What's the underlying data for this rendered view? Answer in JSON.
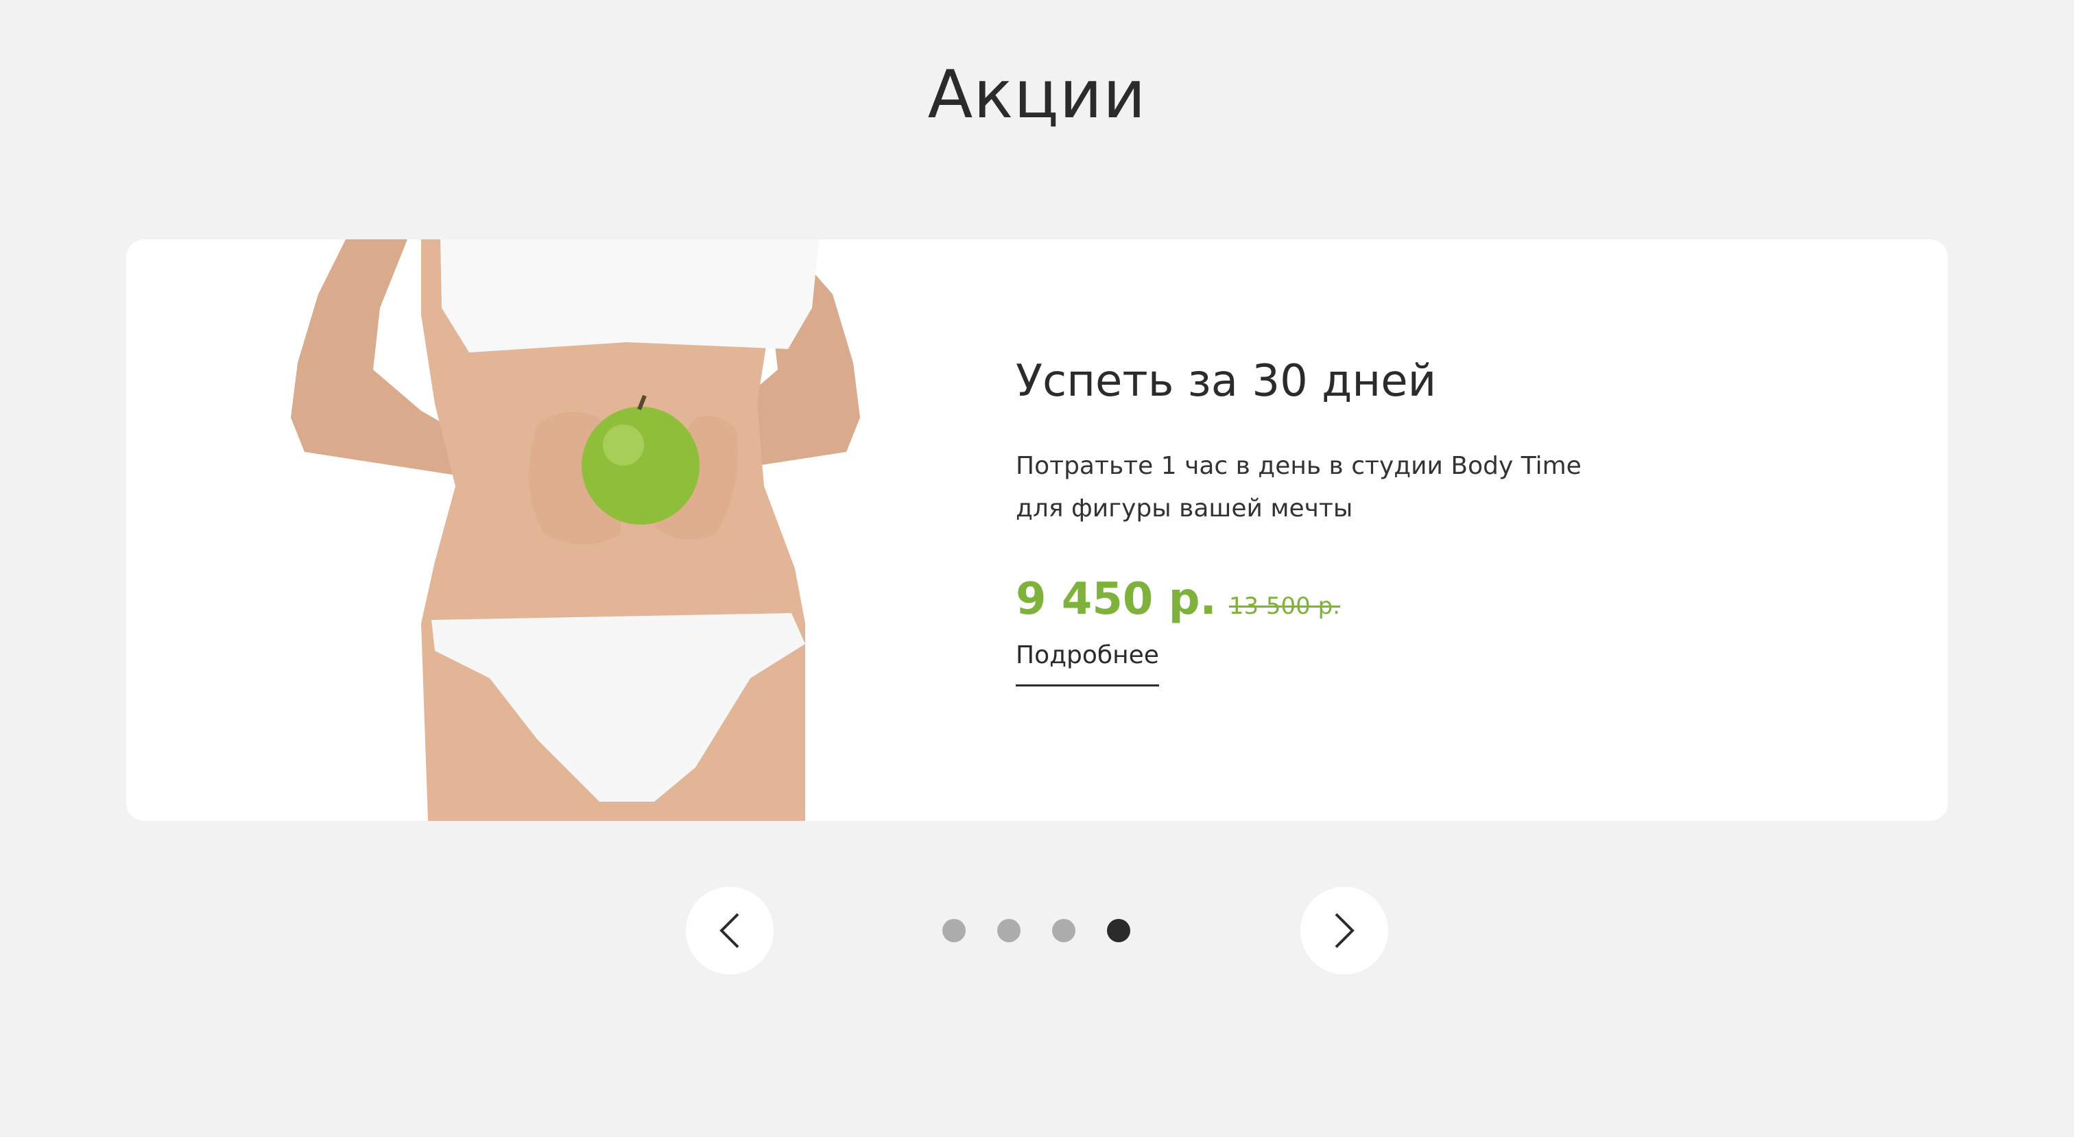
{
  "section": {
    "title": "Акции"
  },
  "promo": {
    "title": "Успеть за 30 дней",
    "description_line1": "Потратьте 1 час в день в студии Body Time",
    "description_line2": "для фигуры вашей мечты",
    "price_new": "9 450 р.",
    "price_old": "13 500 р.",
    "more_label": "Подробнее",
    "image_icon": "woman-holding-green-apple-image"
  },
  "slider": {
    "prev_icon": "chevron-left-icon",
    "next_icon": "chevron-right-icon",
    "dot_count": 4,
    "active_dot": 4
  },
  "colors": {
    "background": "#f2f2f2",
    "card": "#ffffff",
    "accent": "#7fb13d",
    "text": "#2b2b2b",
    "dot_inactive": "#acacac",
    "dot_active": "#2b2b2b"
  }
}
